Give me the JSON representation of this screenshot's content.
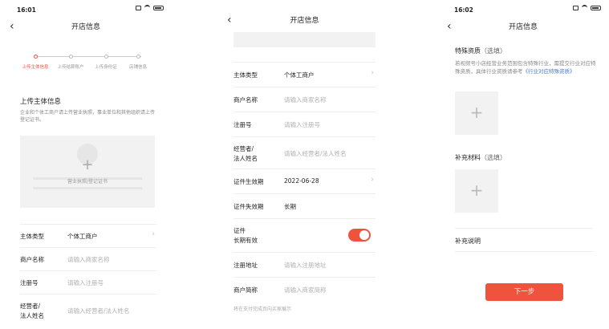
{
  "screen1": {
    "time": "16:01",
    "title": "开店信息",
    "steps": [
      {
        "label": "上传主体信息",
        "active": true
      },
      {
        "label": "上传结算账户",
        "active": false
      },
      {
        "label": "上传身份证",
        "active": false
      },
      {
        "label": "店铺信息",
        "active": false
      }
    ],
    "section_title": "上传主体信息",
    "section_desc": "企业和个体工商户请上传营业执照，事业单位和其他组织请上传登记证书。",
    "upload_caption": "营业执照/登记证书",
    "rows": [
      {
        "label": "主体类型",
        "value": "个体工商户",
        "placeholder": ""
      },
      {
        "label": "商户名称",
        "value": "",
        "placeholder": "请输入商家名称"
      },
      {
        "label": "注册号",
        "value": "",
        "placeholder": "请输入注册号"
      },
      {
        "label": "经营者/",
        "label2": "法人姓名",
        "value": "",
        "placeholder": "请输入经营者/法人姓名"
      }
    ]
  },
  "screen2": {
    "title": "开店信息",
    "rows": [
      {
        "label": "主体类型",
        "value": "个体工商户",
        "placeholder": ""
      },
      {
        "label": "商户名称",
        "value": "",
        "placeholder": "请输入商家名称"
      },
      {
        "label": "注册号",
        "value": "",
        "placeholder": "请输入注册号"
      },
      {
        "label": "经营者/",
        "label2": "法人姓名",
        "value": "",
        "placeholder": "请输入经营者/法人姓名"
      },
      {
        "label": "证件生效期",
        "value": "2022-06-28",
        "placeholder": ""
      },
      {
        "label": "证件失效期",
        "value": "长期",
        "placeholder": ""
      },
      {
        "label": "证件",
        "label2": "长期有效",
        "value": "",
        "placeholder": ""
      },
      {
        "label": "注册地址",
        "value": "",
        "placeholder": "请输入注册地址"
      },
      {
        "label": "商户简称",
        "value": "",
        "placeholder": "请输入商家简称"
      }
    ],
    "toggle_on": true,
    "hint": "将在支付完成页向买家展示"
  },
  "screen3": {
    "time": "16:02",
    "title": "开店信息",
    "special_title": "特殊资质",
    "special_optional": "（选填）",
    "special_desc": "若视频号小店经营业务范围包含特殊行业，需提交行业对应特殊资质，具体行业资质请参考",
    "special_link": "《行业对应特殊资质》",
    "supp_title": "补充材料",
    "supp_optional": "（选填）",
    "note_label": "补充说明",
    "next_button": "下一步"
  },
  "colors": {
    "accent": "#f0533d",
    "link": "#4a7bd0"
  }
}
